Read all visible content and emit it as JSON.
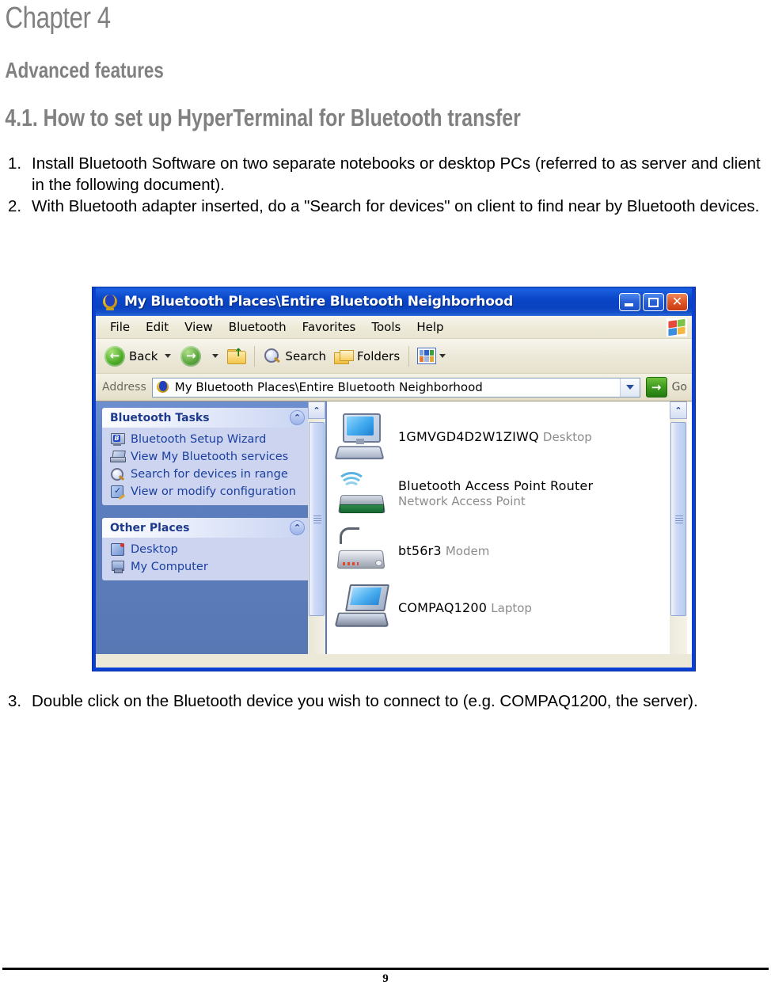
{
  "document": {
    "chapter_title": "Chapter 4",
    "section_heading": "Advanced features",
    "subsection_heading": "4.1. How to set up HyperTerminal for Bluetooth transfer",
    "steps_before": [
      {
        "number": "1.",
        "text": "Install Bluetooth Software on two separate notebooks or desktop PCs (referred to as server and client in the following document)."
      },
      {
        "number": "2.",
        "text": "With Bluetooth adapter inserted, do a \"Search for devices\" on client to find near by Bluetooth devices."
      }
    ],
    "steps_after": [
      {
        "number": "3.",
        "text": "Double click on the Bluetooth device you wish to connect to (e.g. COMPAQ1200, the server)."
      }
    ],
    "page_number": "9"
  },
  "screenshot": {
    "window": {
      "title": "My Bluetooth Places\\Entire Bluetooth Neighborhood",
      "titlebar_icon": "bluetooth-globe-icon",
      "buttons": {
        "minimize": "minimize-button",
        "maximize": "maximize-button",
        "close": "close-button"
      }
    },
    "menubar": {
      "items": [
        "File",
        "Edit",
        "View",
        "Bluetooth",
        "Favorites",
        "Tools",
        "Help"
      ],
      "brand_icon": "windows-flag-icon"
    },
    "toolbar": {
      "back_label": "Back",
      "search_label": "Search",
      "folders_label": "Folders",
      "icons": {
        "back": "back-arrow-icon",
        "forward": "forward-arrow-icon",
        "up": "up-folder-icon",
        "search": "magnifier-icon",
        "folders": "folders-icon",
        "views": "views-icon"
      }
    },
    "address_bar": {
      "label": "Address",
      "value": "My Bluetooth Places\\Entire Bluetooth Neighborhood",
      "go_label": "Go",
      "icon": "bluetooth-globe-icon"
    },
    "sidebar": {
      "panels": [
        {
          "title": "Bluetooth Tasks",
          "items": [
            {
              "label": "Bluetooth Setup Wizard",
              "icon": "bluetooth-wizard-icon"
            },
            {
              "label": "View My Bluetooth services",
              "icon": "laptop-icon"
            },
            {
              "label": "Search for devices in range",
              "icon": "magnifier-icon"
            },
            {
              "label": "View or modify configuration",
              "icon": "configuration-icon"
            }
          ]
        },
        {
          "title": "Other Places",
          "items": [
            {
              "label": "Desktop",
              "icon": "desktop-icon"
            },
            {
              "label": "My Computer",
              "icon": "my-computer-icon"
            }
          ]
        }
      ]
    },
    "devices": [
      {
        "name": "1GMVGD4D2W1ZIWQ",
        "type": "Desktop",
        "icon": "desktop-pc-icon"
      },
      {
        "name": "Bluetooth Access Point Router",
        "type": "Network Access Point",
        "icon": "access-point-icon"
      },
      {
        "name": "bt56r3",
        "type": "Modem",
        "icon": "modem-icon"
      },
      {
        "name": "COMPAQ1200",
        "type": "Laptop",
        "icon": "laptop-device-icon"
      }
    ],
    "colors": {
      "titlebar_blue": "#0a46c8",
      "sidebar_blue": "#5878b4",
      "panel_body": "#ccd4f0",
      "panel_link": "#1b3f9e",
      "chrome_beige": "#ece9d8",
      "heading_gray": "#808080"
    }
  }
}
